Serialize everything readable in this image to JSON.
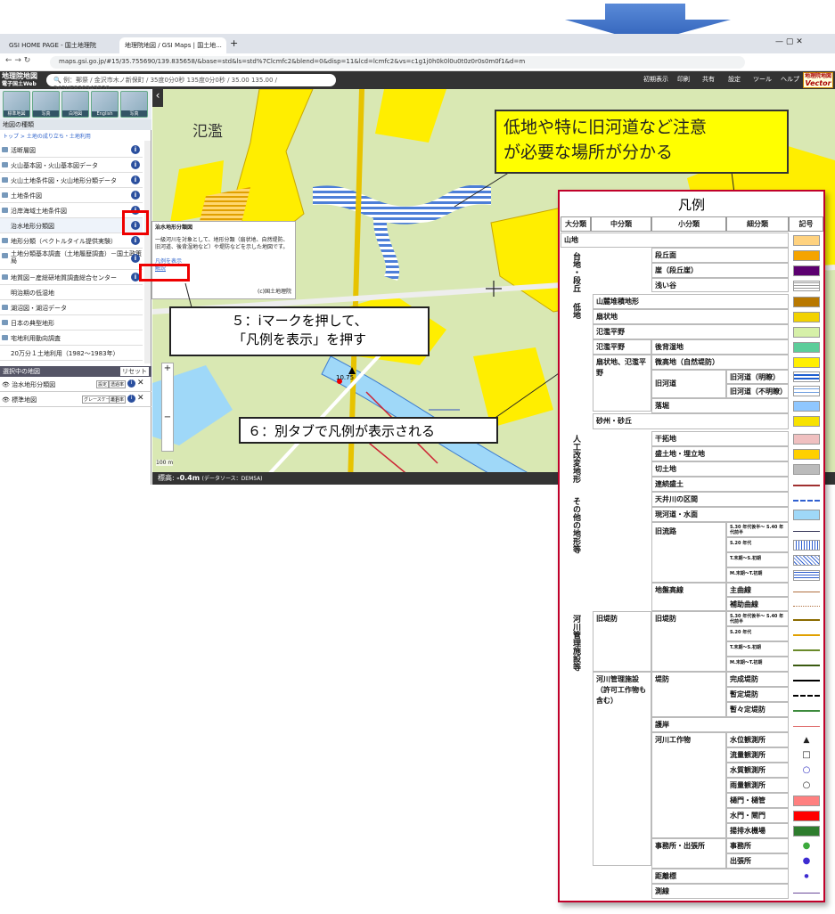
{
  "browser": {
    "tab1": "GSI HOME PAGE - 国土地理院",
    "tab2": "地理院地図 / GSI Maps | 国土地...",
    "url": "maps.gsi.go.jp/#15/35.755690/139.835658/&base=std&ls=std%7Clcmfc2&blend=0&disp=11&lcd=lcmfc2&vs=c1g1j0h0k0l0u0t0z0r0s0m0f1&d=m"
  },
  "gsi": {
    "logo_line1": "地理院地図",
    "logo_line2": "電子国土Web",
    "search_placeholder": "例：郵祭 / 金沢市木ノ新保町 / 35度0分0秒 135度0分0秒 / 35.00 135.00 / 54SUE836949920",
    "buttons": [
      "初期表示",
      "印刷",
      "共有",
      "設定",
      "ツール",
      "ヘルプ"
    ],
    "vector_line1": "地理院地図",
    "vector_line2": "Vector"
  },
  "panel": {
    "thumbs": [
      "標準地図",
      "写真",
      "白地図",
      "English",
      "写真"
    ],
    "title": "地図の種類",
    "breadcrumb": "トップ > 土地の成り立ち・土地利用",
    "items": [
      "活断層図",
      "火山基本図・火山基本図データ",
      "火山土地条件図・火山地形分類データ",
      "土地条件図",
      "沿岸海域土地条件図",
      "治水地形分類図",
      "地形分類（ベクトルタイル提供実験）",
      "土地分類基本調査（土地履歴調査）－国土政策局",
      "地質図－産総研地質調査総合センター",
      "明治期の低湿地",
      "湖沼図・湖沼データ",
      "日本の典型地形",
      "宅地利用動向調査",
      "20万分１土地利用（1982～1983年）"
    ],
    "selected_title": "選択中の地図",
    "reset": "リセット",
    "selected": [
      "治水地形分類図",
      "標準地図"
    ],
    "sel_btn1": "設定",
    "sel_btn2": "透過率",
    "sel_btn3": "グレースケール"
  },
  "popup": {
    "title": "治水地形分類図",
    "body": "一級河川を対象として、地形分類（扇状地、自然堤防、旧河道、後背湿地など）や堤防などを示した地図です。",
    "link": "凡例を表示",
    "link2": "解説",
    "credit": "(c)国土地理院"
  },
  "map": {
    "label": "氾濫",
    "status_prefix": "標高: ",
    "elevation": "-0.4m",
    "source": "(データソース：DEM5A)",
    "scale": "100 m",
    "marker": "10.75"
  },
  "callouts": {
    "yellow_line1": "低地や特に旧河道など注意",
    "yellow_line2": "が必要な場所が分かる",
    "step5_line1": "５：iマークを押して、",
    "step5_line2": "「凡例を表示」を押す",
    "step6": "６：別タブで凡例が表示される"
  },
  "legend": {
    "title": "凡例",
    "headers": [
      "大分類",
      "中分類",
      "小分類",
      "細分類",
      "記号"
    ],
    "yamachi": "山地",
    "daichi": "台地・段丘",
    "teichi": "低地",
    "jinko": "人工改変地形",
    "sonota": "その他の地形等",
    "kasen": "河川管理施設等",
    "daichi_rows": [
      "段丘面",
      "崖（段丘崖）",
      "浅い谷"
    ],
    "teichi_rows": [
      "山麓堆積地形",
      "扇状地",
      "氾濫平野",
      "氾濫平野",
      "後背湿地",
      "扇状地、氾濫平野",
      "微高地（自然堤防）",
      "旧河道",
      "旧河道（明瞭）",
      "旧河道（不明瞭）",
      "落堀",
      "砂州・砂丘"
    ],
    "jinko_rows": [
      "干拓地",
      "盛土地・埋立地",
      "切土地",
      "連続盛土"
    ],
    "sonota_rows": [
      "天井川の区間",
      "現河道・水面",
      "旧流路",
      "S.30 年代後半～ S.40 年代前半",
      "S.20 年代",
      "T.末期～S.初期",
      "M.末期～T.初期",
      "地盤高線",
      "主曲線",
      "補助曲線"
    ],
    "kasen_rows": [
      "旧堤防",
      "旧堤防",
      "S.30 年代後半～ S.40 年代前半",
      "S.20 年代",
      "T.末期～S.初期",
      "M.末期～T.初期",
      "河川管理施設（許可工作物も含む）",
      "堤防",
      "完成堤防",
      "暫定堤防",
      "暫々定堤防",
      "護岸",
      "河川工作物",
      "水位観測所",
      "流量観測所",
      "水質観測所",
      "雨量観測所",
      "樋門・樋管",
      "水門・閘門",
      "揚排水機場",
      "事務所・出張所",
      "事務所",
      "出張所",
      "距離標",
      "測線"
    ],
    "colors": {
      "yamachi": "#ffd27f",
      "dankyu": "#f5a400",
      "gake": "#5c0070",
      "sanroku": "#b87800",
      "senjochi": "#f2d200",
      "hanran": "#d6f0a8",
      "kohai": "#5ccd9a",
      "bikochi": "#ffef00",
      "kyukado": "#1f5fd0",
      "otobori": "#8fc7ff",
      "sasu": "#f7e200",
      "kantaku": "#f0c0c0",
      "morido": "#ffd000",
      "kirido": "#bbbbbb",
      "renzoku": "#a03030",
      "tenjo": "#3060d0",
      "genkado": "#9fd8f8",
      "hisui": "#ff8080",
      "suimon": "#ff0000",
      "yohai": "#2e7d2e",
      "jimusho": "#3caa3c",
      "shucho": "#3d2bd1"
    }
  }
}
